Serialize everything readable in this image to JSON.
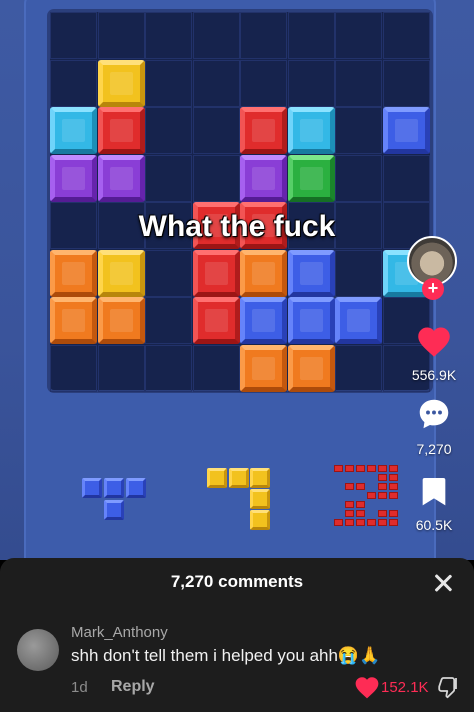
{
  "video": {
    "caption": "What the fuck",
    "board": {
      "rows": 8,
      "cols": 8,
      "blocks": [
        {
          "r": 1,
          "c": 1,
          "color": "yellow"
        },
        {
          "r": 2,
          "c": 0,
          "color": "cyan"
        },
        {
          "r": 2,
          "c": 1,
          "color": "red"
        },
        {
          "r": 2,
          "c": 4,
          "color": "red"
        },
        {
          "r": 2,
          "c": 5,
          "color": "cyan"
        },
        {
          "r": 2,
          "c": 7,
          "color": "blue"
        },
        {
          "r": 3,
          "c": 0,
          "color": "purple"
        },
        {
          "r": 3,
          "c": 1,
          "color": "purple"
        },
        {
          "r": 3,
          "c": 4,
          "color": "purple"
        },
        {
          "r": 3,
          "c": 5,
          "color": "green"
        },
        {
          "r": 4,
          "c": 3,
          "color": "red"
        },
        {
          "r": 4,
          "c": 4,
          "color": "red"
        },
        {
          "r": 5,
          "c": 0,
          "color": "orange"
        },
        {
          "r": 5,
          "c": 1,
          "color": "yellow"
        },
        {
          "r": 5,
          "c": 3,
          "color": "red"
        },
        {
          "r": 5,
          "c": 4,
          "color": "orange"
        },
        {
          "r": 5,
          "c": 5,
          "color": "blue"
        },
        {
          "r": 5,
          "c": 7,
          "color": "cyan"
        },
        {
          "r": 6,
          "c": 0,
          "color": "orange"
        },
        {
          "r": 6,
          "c": 1,
          "color": "orange"
        },
        {
          "r": 6,
          "c": 3,
          "color": "red"
        },
        {
          "r": 6,
          "c": 4,
          "color": "blue"
        },
        {
          "r": 6,
          "c": 5,
          "color": "blue"
        },
        {
          "r": 6,
          "c": 6,
          "color": "blue"
        },
        {
          "r": 7,
          "c": 4,
          "color": "orange"
        },
        {
          "r": 7,
          "c": 5,
          "color": "orange"
        }
      ]
    }
  },
  "actions": {
    "likes": "556.9K",
    "comments": "7,270",
    "saves": "60.5K",
    "follow_symbol": "+"
  },
  "comments_sheet": {
    "title": "7,270 comments",
    "comment": {
      "username": "Mark_Anthony",
      "text": "shh don't tell them i helped you ahh😭🙏",
      "time": "1d",
      "reply_label": "Reply",
      "likes": "152.1K"
    }
  },
  "colors": {
    "accent": "#fe2c55",
    "sheet_bg": "#1d1d1d",
    "board_bg": "#16234d"
  },
  "icons": [
    "heart-icon",
    "comment-bubble-icon",
    "bookmark-icon",
    "close-icon",
    "dislike-icon",
    "follow-plus-icon"
  ]
}
